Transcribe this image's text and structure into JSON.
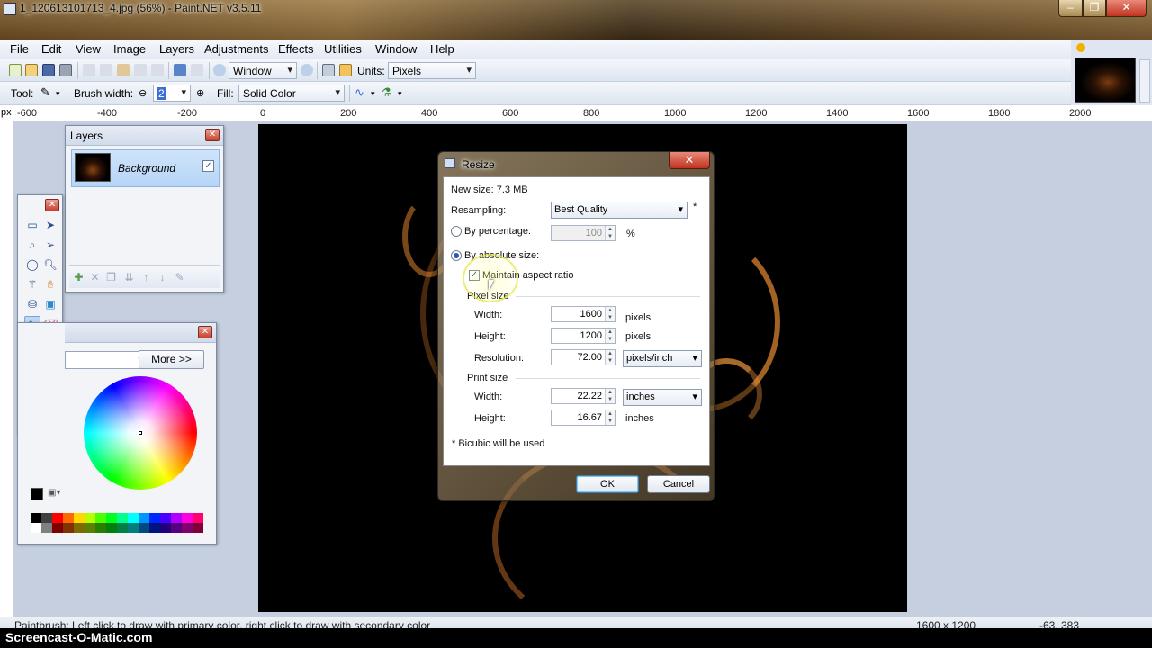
{
  "window": {
    "title": "1_120613101713_4.jpg (56%) - Paint.NET v3.5.11",
    "minimize_icon": "minimize-icon",
    "maximize_icon": "maximize-icon",
    "close_icon": "close-icon"
  },
  "menu": [
    "File",
    "Edit",
    "View",
    "Image",
    "Layers",
    "Adjustments",
    "Effects",
    "Utilities",
    "Window",
    "Help"
  ],
  "toolbar1": {
    "zoom_value": "Window",
    "units_label": "Units:",
    "units_value": "Pixels"
  },
  "toolbar2": {
    "tool_label": "Tool:",
    "brush_width_label": "Brush width:",
    "brush_width_value": "2",
    "fill_label": "Fill:",
    "fill_value": "Solid Color"
  },
  "ruler": {
    "unit": "px",
    "ticks": [
      "-600",
      "-400",
      "-200",
      "0",
      "200",
      "400",
      "600",
      "800",
      "1000",
      "1200",
      "1400",
      "1600",
      "1800",
      "2000"
    ]
  },
  "layers_panel": {
    "title": "Layers",
    "layer_name": "Background",
    "layer_visible": true,
    "close_label": "✕"
  },
  "tools_panel": {
    "close_label": "✕"
  },
  "colors_panel": {
    "more_button": "More >>",
    "close_label": "✕",
    "palette_colors": [
      "#000000",
      "#404040",
      "#ff0000",
      "#ff6a00",
      "#ffd800",
      "#b6ff00",
      "#4cff00",
      "#00ff21",
      "#00ff90",
      "#00ffff",
      "#0094ff",
      "#0026ff",
      "#4800ff",
      "#b200ff",
      "#ff00dc",
      "#ff006e",
      "#ffffff",
      "#808080",
      "#7f0000",
      "#7f3300",
      "#7f6a00",
      "#5b7f00",
      "#267f00",
      "#007f0e",
      "#007f46",
      "#007f7f",
      "#004a7f",
      "#00137f",
      "#21007f",
      "#57007f",
      "#7f006e",
      "#7f0037"
    ]
  },
  "resize_dialog": {
    "title": "Resize",
    "close_label": "✕",
    "new_size": "New size: 7.3 MB",
    "resampling_label": "Resampling:",
    "resampling_value": "Best Quality",
    "resampling_note": "*",
    "by_percentage_label": "By percentage:",
    "percentage_value": "100",
    "percent_sign": "%",
    "by_absolute_label": "By absolute size:",
    "maintain_aspect_label": "Maintain aspect ratio",
    "maintain_aspect_checked": true,
    "pixel_size_label": "Pixel size",
    "width_label": "Width:",
    "width_value": "1600",
    "width_unit": "pixels",
    "height_label": "Height:",
    "height_value": "1200",
    "height_unit": "pixels",
    "resolution_label": "Resolution:",
    "resolution_value": "72.00",
    "resolution_unit": "pixels/inch",
    "print_size_label": "Print size",
    "print_width_label": "Width:",
    "print_width_value": "22.22",
    "print_width_unit": "inches",
    "print_height_label": "Height:",
    "print_height_value": "16.67",
    "print_height_unit": "inches",
    "footnote": "* Bicubic will be used",
    "ok_label": "OK",
    "cancel_label": "Cancel"
  },
  "status": {
    "hint": "Paintbrush: Left click to draw with primary color, right click to draw with secondary color",
    "image_size": "1600 x 1200",
    "cursor_coords": "-63, 383"
  },
  "watermark": "Screencast-O-Matic.com"
}
